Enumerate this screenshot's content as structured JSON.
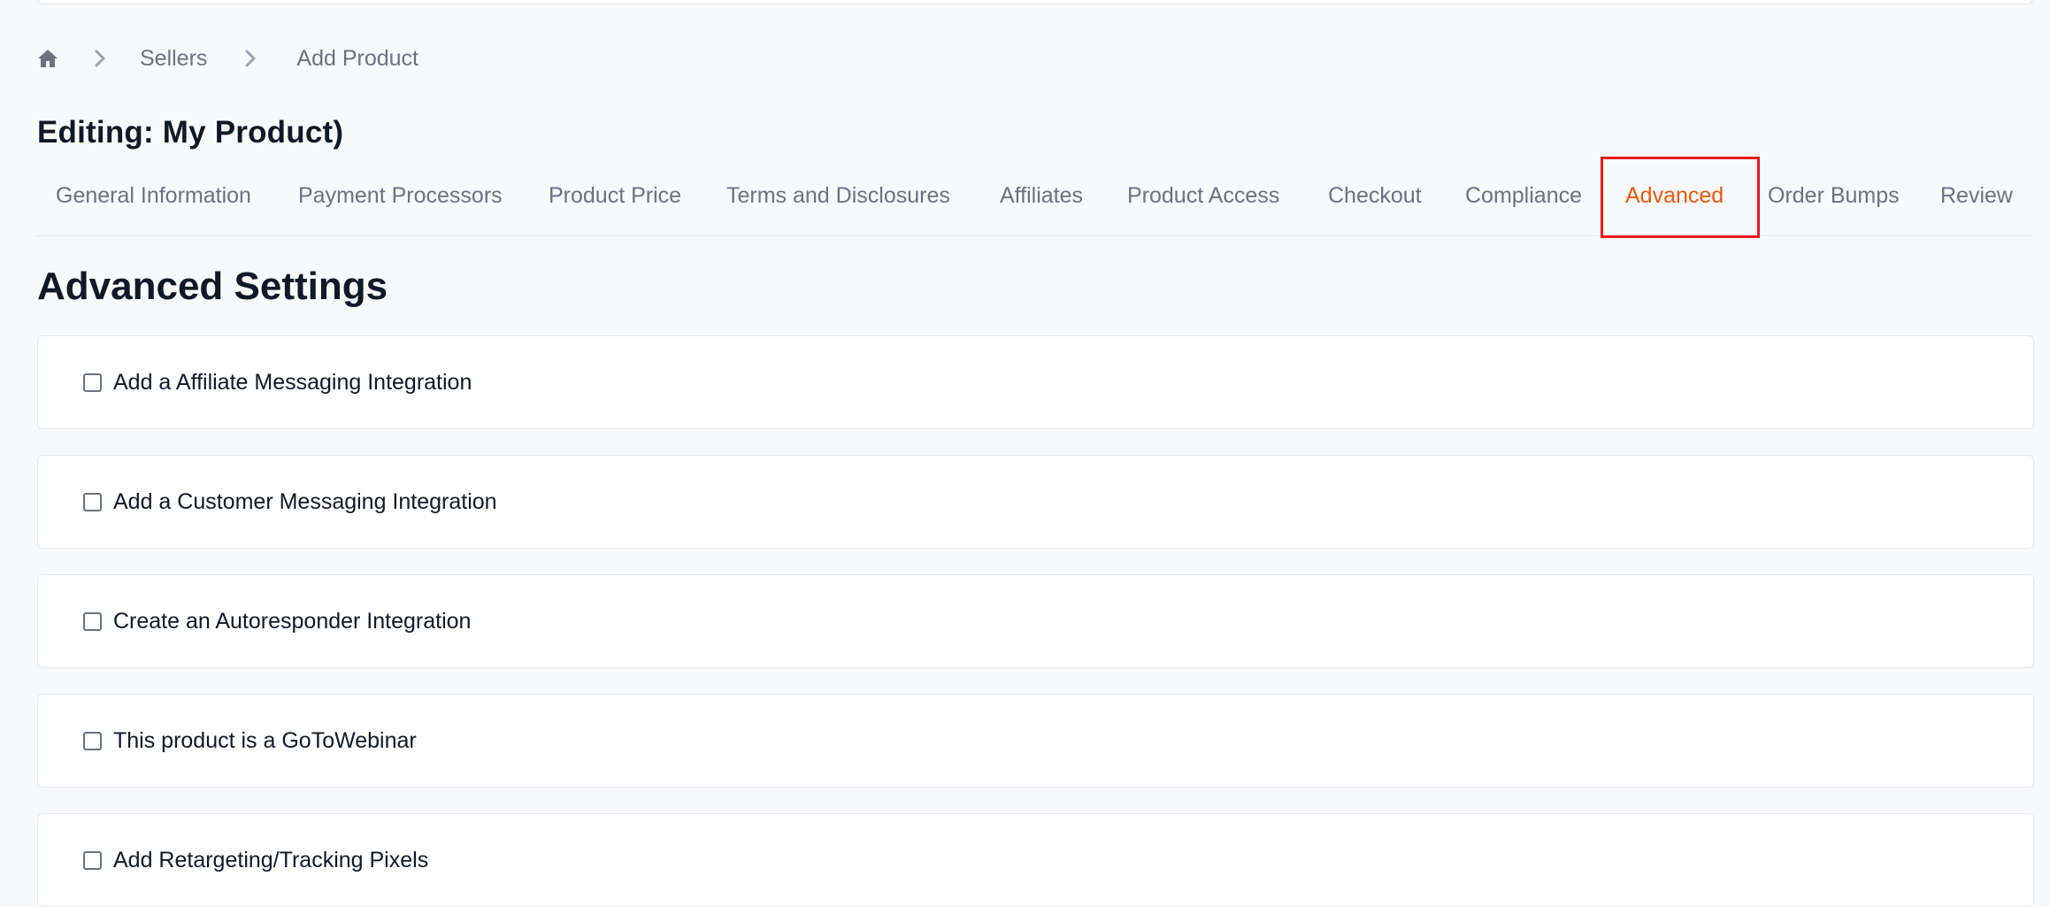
{
  "breadcrumb": {
    "home_icon": "home-icon",
    "separator_icon": "chevron-right-icon",
    "items": [
      "Sellers",
      "Add Product"
    ]
  },
  "page": {
    "title": "Editing: My Product)"
  },
  "tabs": [
    {
      "label": "General Information",
      "active": false
    },
    {
      "label": "Payment Processors",
      "active": false
    },
    {
      "label": "Product Price",
      "active": false
    },
    {
      "label": "Terms and Disclosures",
      "active": false
    },
    {
      "label": "Affiliates",
      "active": false
    },
    {
      "label": "Product Access",
      "active": false
    },
    {
      "label": "Checkout",
      "active": false
    },
    {
      "label": "Compliance",
      "active": false
    },
    {
      "label": "Advanced",
      "active": true
    },
    {
      "label": "Order Bumps",
      "active": false
    },
    {
      "label": "Review",
      "active": false
    }
  ],
  "section": {
    "title": "Advanced Settings"
  },
  "options": [
    {
      "label": "Add a Affiliate Messaging Integration",
      "checked": false
    },
    {
      "label": "Add a Customer Messaging Integration",
      "checked": false
    },
    {
      "label": "Create an Autoresponder Integration",
      "checked": false
    },
    {
      "label": "This product is a GoToWebinar",
      "checked": false
    },
    {
      "label": "Add Retargeting/Tracking Pixels",
      "checked": false
    }
  ],
  "colors": {
    "background": "#f8f9fb",
    "active_tab": "#ea580c",
    "highlight_box": "#e51d1d",
    "muted_text": "#6b7280",
    "primary_text": "#111827"
  }
}
